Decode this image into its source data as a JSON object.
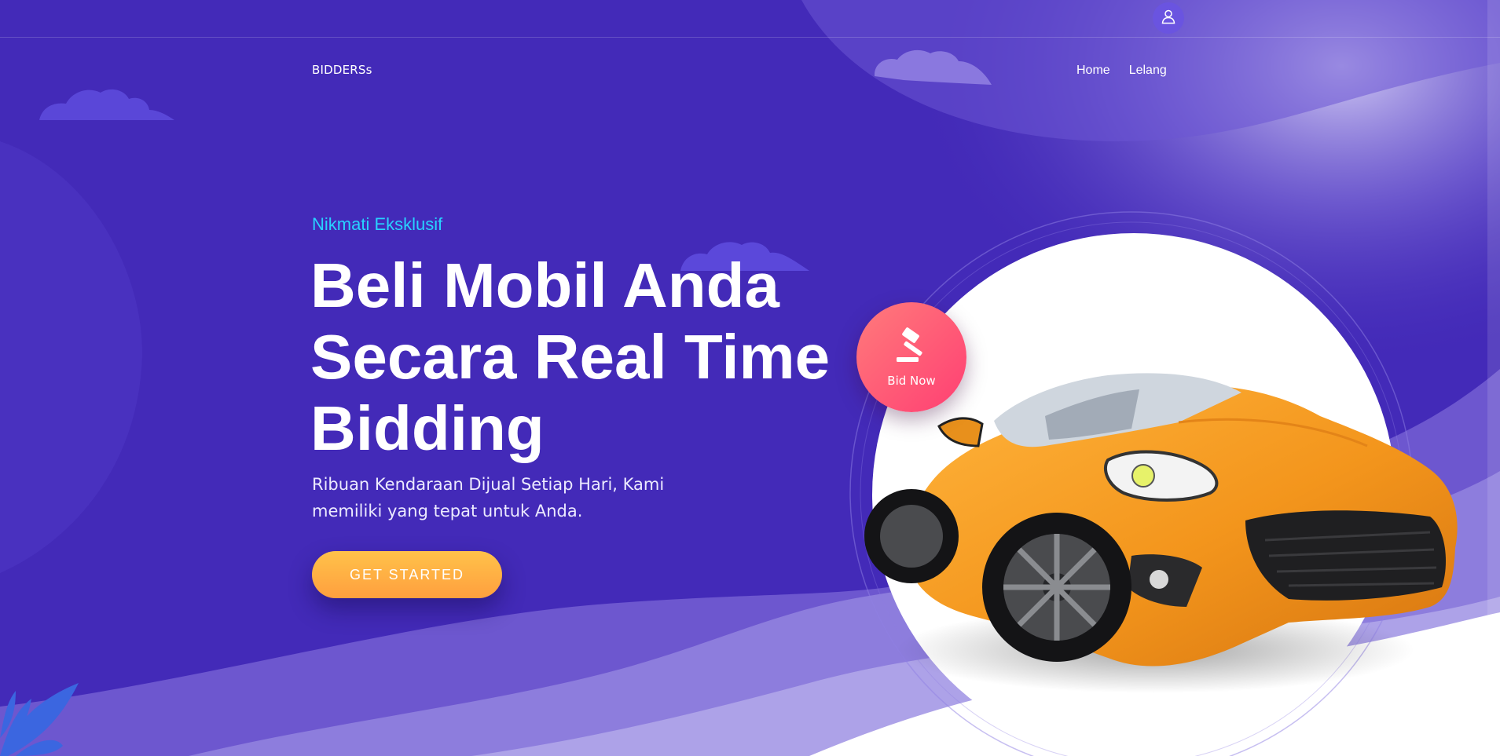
{
  "header": {
    "brand": "BIDDERSs",
    "nav": [
      "Home",
      "Lelang"
    ],
    "user_icon": "user-icon"
  },
  "hero": {
    "eyebrow": "Nikmati Eksklusif",
    "headline_lines": [
      "Beli Mobil Anda",
      "Secara Real Time",
      "Bidding"
    ],
    "subtitle": "Ribuan Kendaraan Dijual Setiap Hari, Kami memiliki yang tepat untuk Anda.",
    "cta_label": "GET STARTED",
    "bid_label": "Bid Now",
    "bid_icon": "gavel-icon",
    "image": "orange-sports-car"
  },
  "colors": {
    "background": "#432ab8",
    "eyebrow": "#28d3ff",
    "cta": "#ffb043",
    "bid_badge": "#ff4f76",
    "car": "#f39a1f"
  }
}
